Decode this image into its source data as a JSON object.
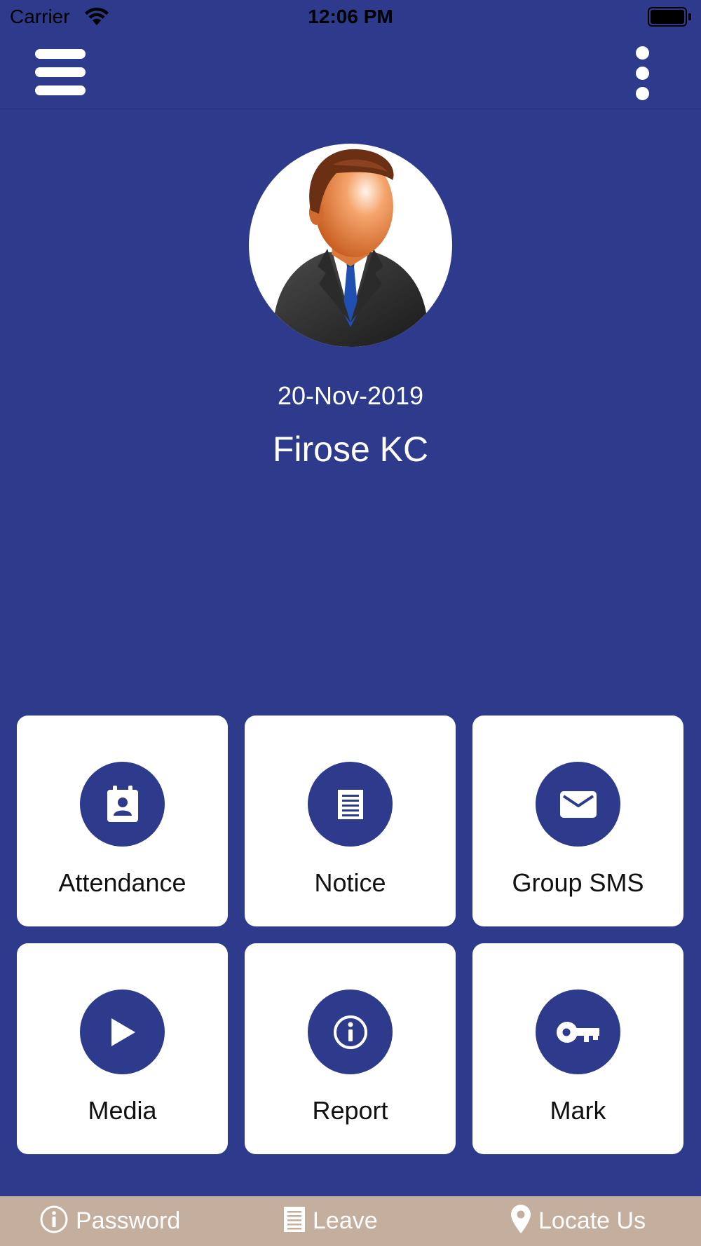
{
  "status_bar": {
    "carrier": "Carrier",
    "time": "12:06 PM"
  },
  "nav": {
    "menu_icon": "hamburger-menu-icon",
    "more_icon": "more-vertical-icon"
  },
  "profile": {
    "date": "20-Nov-2019",
    "name": "Firose KC"
  },
  "tiles": [
    {
      "label": "Attendance",
      "icon": "attendance-contact-icon"
    },
    {
      "label": "Notice",
      "icon": "notice-document-icon"
    },
    {
      "label": "Group SMS",
      "icon": "envelope-icon"
    },
    {
      "label": "Media",
      "icon": "play-icon"
    },
    {
      "label": "Report",
      "icon": "info-icon"
    },
    {
      "label": "Mark",
      "icon": "key-icon"
    }
  ],
  "footer": {
    "password": "Password",
    "leave": "Leave",
    "locate_us": "Locate Us"
  },
  "colors": {
    "primary": "#2e3a8c",
    "tile_bg": "#ffffff",
    "footer_bg": "#c4ae9e"
  }
}
